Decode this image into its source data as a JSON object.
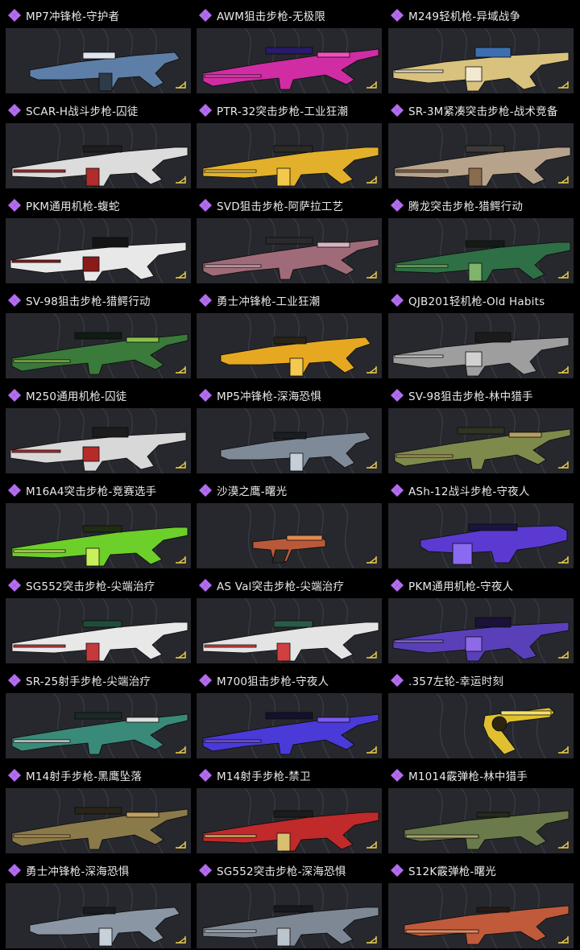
{
  "items": [
    {
      "title": "MP7冲锋枪-守护者",
      "weapon": "smg",
      "colors": [
        "#5d7ea6",
        "#dfe6ee",
        "#2f3a48"
      ],
      "icon": "rare-diamond-icon"
    },
    {
      "title": "AWM狙击步枪-无极限",
      "weapon": "sniper",
      "colors": [
        "#d02da4",
        "#2a1a6c",
        "#f44ec0"
      ],
      "icon": "rare-diamond-icon"
    },
    {
      "title": "M249轻机枪-异域战争",
      "weapon": "lmg",
      "colors": [
        "#d9c27e",
        "#3d6fb0",
        "#f1e9d0"
      ],
      "icon": "rare-diamond-icon"
    },
    {
      "title": "SCAR-H战斗步枪-囚徒",
      "weapon": "rifle",
      "colors": [
        "#dcdcdc",
        "#1e1e1e",
        "#b12c2c"
      ],
      "icon": "rare-diamond-icon"
    },
    {
      "title": "PTR-32突击步枪-工业狂潮",
      "weapon": "rifle",
      "colors": [
        "#e2b02a",
        "#2c2a24",
        "#f4c84a"
      ],
      "icon": "rare-diamond-icon"
    },
    {
      "title": "SR-3M紧凑突击步枪-战术竞备",
      "weapon": "rifle",
      "colors": [
        "#b7a38c",
        "#3b3a37",
        "#8b6b4e"
      ],
      "icon": "rare-diamond-icon"
    },
    {
      "title": "PKM通用机枪-蝮蛇",
      "weapon": "lmg",
      "colors": [
        "#e8e8e8",
        "#141414",
        "#8a1a1a"
      ],
      "icon": "rare-diamond-icon"
    },
    {
      "title": "SVD狙击步枪-阿萨拉工艺",
      "weapon": "sniper",
      "colors": [
        "#a06b78",
        "#2a2a2a",
        "#d7b3c0"
      ],
      "icon": "rare-diamond-icon"
    },
    {
      "title": "腾龙突击步枪-猎鳄行动",
      "weapon": "rifle",
      "colors": [
        "#2f6f45",
        "#161a16",
        "#7fb56a"
      ],
      "icon": "rare-diamond-icon"
    },
    {
      "title": "SV-98狙击步枪-猎鳄行动",
      "weapon": "sniper",
      "colors": [
        "#3a7a3a",
        "#0f1c12",
        "#8ac04a"
      ],
      "icon": "rare-diamond-icon"
    },
    {
      "title": "勇士冲锋枪-工业狂潮",
      "weapon": "smg",
      "colors": [
        "#e6a820",
        "#2a2418",
        "#f5c850"
      ],
      "icon": "rare-diamond-icon"
    },
    {
      "title": "QJB201轻机枪-Old Habits",
      "weapon": "lmg",
      "colors": [
        "#9e9e9e",
        "#1b1b1b",
        "#d0d0d0"
      ],
      "icon": "rare-diamond-icon"
    },
    {
      "title": "M250通用机枪-囚徒",
      "weapon": "lmg",
      "colors": [
        "#d8d8d8",
        "#1c1c1c",
        "#b72a2a"
      ],
      "icon": "rare-diamond-icon"
    },
    {
      "title": "MP5冲锋枪-深海恐惧",
      "weapon": "smg",
      "colors": [
        "#7f8a98",
        "#1a1d22",
        "#c5cfd8"
      ],
      "icon": "rare-diamond-icon"
    },
    {
      "title": "SV-98狙击步枪-林中猎手",
      "weapon": "sniper",
      "colors": [
        "#7d8a4c",
        "#2e3520",
        "#b5a060"
      ],
      "icon": "rare-diamond-icon"
    },
    {
      "title": "M16A4突击步枪-竞赛选手",
      "weapon": "rifle",
      "colors": [
        "#6ccf2a",
        "#1f2d12",
        "#c8f05a"
      ],
      "icon": "rare-diamond-icon"
    },
    {
      "title": "沙漠之鹰-曙光",
      "weapon": "pistol",
      "colors": [
        "#b85a3a",
        "#2a2a2a",
        "#e08a50"
      ],
      "icon": "rare-diamond-icon"
    },
    {
      "title": "ASh-12战斗步枪-守夜人",
      "weapon": "bullpup",
      "colors": [
        "#5a3ad0",
        "#1a1440",
        "#8a6af0"
      ],
      "icon": "rare-diamond-icon"
    },
    {
      "title": "SG552突击步枪-尖端治疗",
      "weapon": "rifle",
      "colors": [
        "#e8e8e8",
        "#1f4d3a",
        "#c43a3a"
      ],
      "icon": "rare-diamond-icon"
    },
    {
      "title": "AS Val突击步枪-尖端治疗",
      "weapon": "rifle",
      "colors": [
        "#e4e4e4",
        "#2a5a48",
        "#d04040"
      ],
      "icon": "rare-diamond-icon"
    },
    {
      "title": "PKM通用机枪-守夜人",
      "weapon": "lmg",
      "colors": [
        "#5a40b8",
        "#1a1238",
        "#8c6ae8"
      ],
      "icon": "rare-diamond-icon"
    },
    {
      "title": "SR-25射手步枪-尖端治疗",
      "weapon": "sniper",
      "colors": [
        "#3a8a7a",
        "#1a2a26",
        "#e0e0e0"
      ],
      "icon": "rare-diamond-icon"
    },
    {
      "title": "M700狙击步枪-守夜人",
      "weapon": "sniper",
      "colors": [
        "#4a3ad8",
        "#14102e",
        "#7a5af0"
      ],
      "icon": "rare-diamond-icon"
    },
    {
      "title": ".357左轮-幸运时刻",
      "weapon": "revolver",
      "colors": [
        "#e0c030",
        "#2a2410",
        "#f4e070"
      ],
      "icon": "rare-diamond-icon"
    },
    {
      "title": "M14射手步枪-黑鹰坠落",
      "weapon": "sniper",
      "colors": [
        "#8a7a4a",
        "#2a2418",
        "#c0a060"
      ],
      "icon": "rare-diamond-icon"
    },
    {
      "title": "M14射手步枪-禁卫",
      "weapon": "rifle",
      "colors": [
        "#c02a2a",
        "#1c1c1c",
        "#d8c070"
      ],
      "icon": "rare-diamond-icon"
    },
    {
      "title": "M1014霰弹枪-林中猎手",
      "weapon": "shotgun",
      "colors": [
        "#6a7a4a",
        "#262a1a",
        "#a8a070"
      ],
      "icon": "rare-diamond-icon"
    },
    {
      "title": "勇士冲锋枪-深海恐惧",
      "weapon": "smg",
      "colors": [
        "#8a96a4",
        "#181b20",
        "#c8d0da"
      ],
      "icon": "rare-diamond-icon"
    },
    {
      "title": "SG552突击步枪-深海恐惧",
      "weapon": "rifle",
      "colors": [
        "#7e8894",
        "#15181c",
        "#bcc4ce"
      ],
      "icon": "rare-diamond-icon"
    },
    {
      "title": "S12K霰弹枪-曙光",
      "weapon": "shotgun",
      "colors": [
        "#c05a3a",
        "#241a16",
        "#e08a60"
      ],
      "icon": "rare-diamond-icon"
    }
  ],
  "theme": {
    "rarity_color": "#b46cf0",
    "panel_bg": "#26282d",
    "corner_icon": "expand-corner-icon"
  }
}
